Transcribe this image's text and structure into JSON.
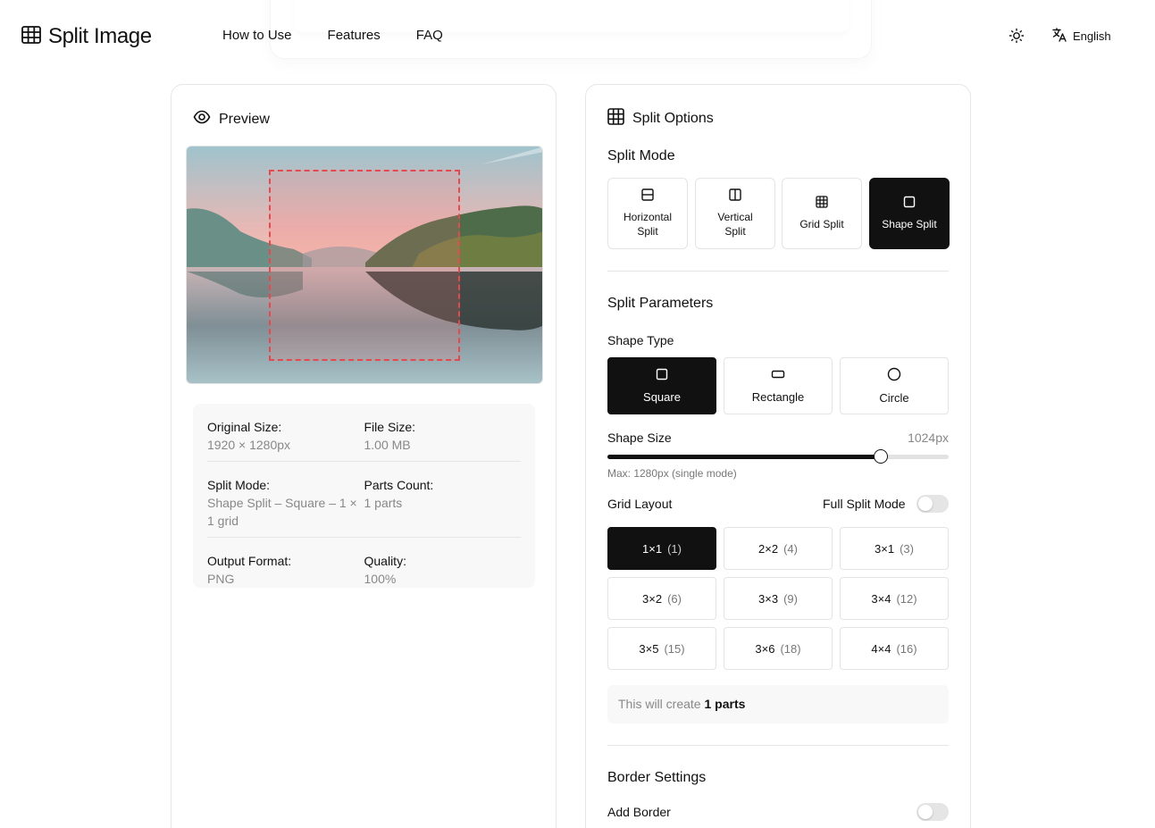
{
  "header": {
    "app_title": "Split Image",
    "nav": [
      "How to Use",
      "Features",
      "FAQ"
    ],
    "language": "English"
  },
  "preview": {
    "title": "Preview",
    "info": [
      {
        "label": "Original Size:",
        "value": "1920 × 1280px"
      },
      {
        "label": "File Size:",
        "value": "1.00 MB"
      },
      {
        "label": "Split Mode:",
        "value": "Shape Split – Square – 1 × 1 grid"
      },
      {
        "label": "Parts Count:",
        "value": "1 parts"
      },
      {
        "label": "Output Format:",
        "value": "PNG"
      },
      {
        "label": "Quality:",
        "value": "100%"
      }
    ]
  },
  "options": {
    "title": "Split Options",
    "split_mode_title": "Split Mode",
    "modes": [
      {
        "label": "Horizontal Split",
        "icon": "horizontal-split-icon",
        "active": false
      },
      {
        "label": "Vertical Split",
        "icon": "vertical-split-icon",
        "active": false
      },
      {
        "label": "Grid Split",
        "icon": "grid-icon",
        "active": false
      },
      {
        "label": "Shape Split",
        "icon": "square-icon",
        "active": true
      }
    ],
    "params_title": "Split Parameters",
    "shape_type_label": "Shape Type",
    "shapes": [
      {
        "label": "Square",
        "icon": "square-icon",
        "active": true
      },
      {
        "label": "Rectangle",
        "icon": "rectangle-icon",
        "active": false
      },
      {
        "label": "Circle",
        "icon": "circle-icon",
        "active": false
      }
    ],
    "shape_size_label": "Shape Size",
    "shape_size_value": "1024px",
    "shape_size_fraction": 0.8,
    "shape_size_hint": "Max: 1280px (single mode)",
    "grid_layout_label": "Grid Layout",
    "full_split_label": "Full Split Mode",
    "full_split_on": false,
    "grids": [
      {
        "label": "1×1",
        "count": "(1)",
        "active": true
      },
      {
        "label": "2×2",
        "count": "(4)",
        "active": false
      },
      {
        "label": "3×1",
        "count": "(3)",
        "active": false
      },
      {
        "label": "3×2",
        "count": "(6)",
        "active": false
      },
      {
        "label": "3×3",
        "count": "(9)",
        "active": false
      },
      {
        "label": "3×4",
        "count": "(12)",
        "active": false
      },
      {
        "label": "3×5",
        "count": "(15)",
        "active": false
      },
      {
        "label": "3×6",
        "count": "(18)",
        "active": false
      },
      {
        "label": "4×4",
        "count": "(16)",
        "active": false
      }
    ],
    "parts_note_prefix": "This will create",
    "parts_note_value": "1 parts",
    "border_title": "Border Settings",
    "add_border_label": "Add Border",
    "add_border_on": false
  }
}
